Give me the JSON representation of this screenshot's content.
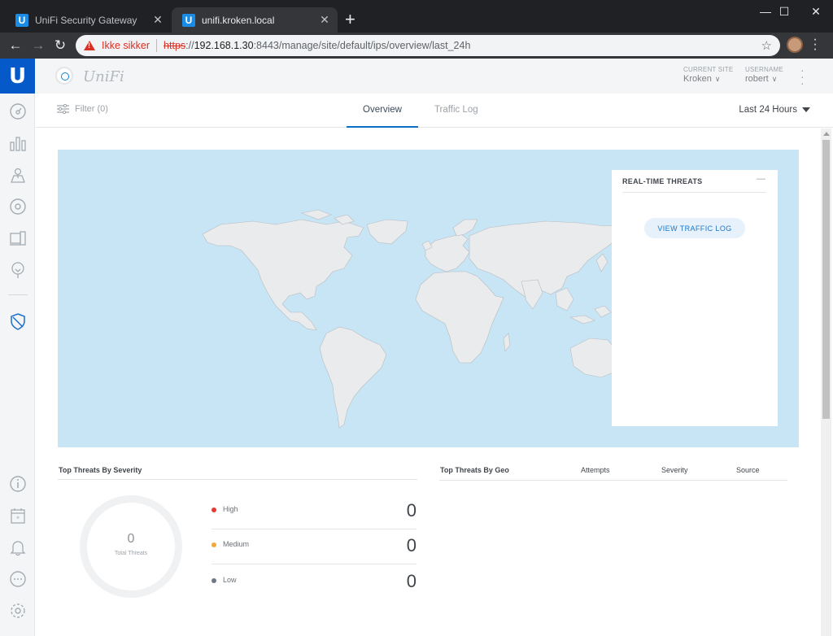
{
  "browser": {
    "tabs": [
      {
        "title": "UniFi Security Gateway",
        "favicon": "U"
      },
      {
        "title": "unifi.kroken.local",
        "favicon": "U"
      }
    ],
    "new_tab": "+",
    "window_controls": [
      "—",
      "☐",
      "✕"
    ],
    "address": {
      "warning": "Ikke sikker",
      "protocol": "https",
      "separator": "://",
      "host": "192.168.1.30",
      "path": ":8443/manage/site/default/ips/overview/last_24h"
    }
  },
  "app": {
    "logo_letter": "U",
    "brand": "UniFi",
    "current_site": {
      "label": "CURRENT SITE",
      "value": "Kroken"
    },
    "username": {
      "label": "USERNAME",
      "value": "robert"
    },
    "filter": "Filter (0)",
    "tabs": [
      "Overview",
      "Traffic Log"
    ],
    "active_tab": "Overview",
    "time_range": "Last 24 Hours",
    "accent": "#0559c9"
  },
  "threats_panel": {
    "title": "REAL-TIME THREATS",
    "minimize": "—",
    "button": "VIEW TRAFFIC LOG"
  },
  "severity": {
    "title": "Top Threats By Severity",
    "total": "0",
    "total_label": "Total Threats",
    "rows": [
      {
        "name": "High",
        "value": "0",
        "color": "#e53935"
      },
      {
        "name": "Medium",
        "value": "0",
        "color": "#f0a93b"
      },
      {
        "name": "Low",
        "value": "0",
        "color": "#6e7787"
      }
    ]
  },
  "geo": {
    "title": "Top Threats By Geo",
    "columns": [
      "Attempts",
      "Severity",
      "Source"
    ]
  }
}
